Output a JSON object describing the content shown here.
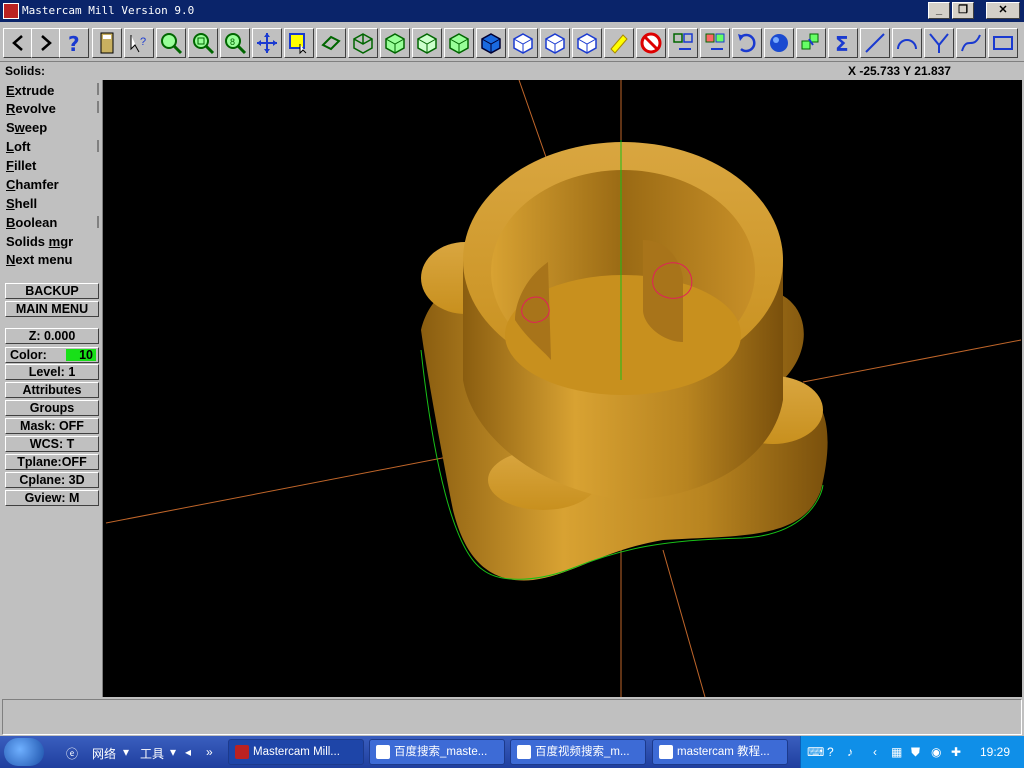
{
  "window": {
    "title": "Mastercam Mill Version 9.0"
  },
  "toolbar": {
    "buttons": [
      {
        "name": "back-arrow-icon"
      },
      {
        "name": "forward-arrow-icon"
      },
      {
        "name": "help-icon"
      },
      {
        "name": "calculator-icon"
      },
      {
        "name": "pointer-help-icon"
      },
      {
        "name": "zoom-window-icon"
      },
      {
        "name": "zoom-out-icon"
      },
      {
        "name": "zoom-fit-icon"
      },
      {
        "name": "pan-icon"
      },
      {
        "name": "select-window-icon"
      },
      {
        "name": "rotate-icon"
      },
      {
        "name": "view-top-icon"
      },
      {
        "name": "view-front-icon"
      },
      {
        "name": "view-side-icon"
      },
      {
        "name": "view-iso-icon"
      },
      {
        "name": "view-shaded-1-icon"
      },
      {
        "name": "view-shaded-2-icon"
      },
      {
        "name": "view-shaded-3-icon"
      },
      {
        "name": "view-shaded-4-icon"
      },
      {
        "name": "eraser-icon"
      },
      {
        "name": "no-entry-icon"
      },
      {
        "name": "transform-1-icon"
      },
      {
        "name": "transform-2-icon"
      },
      {
        "name": "undo-icon"
      },
      {
        "name": "sphere-icon"
      },
      {
        "name": "layers-icon"
      },
      {
        "name": "sigma-icon"
      },
      {
        "name": "line-icon"
      },
      {
        "name": "arc-icon"
      },
      {
        "name": "fillet-icon"
      },
      {
        "name": "spline-icon"
      },
      {
        "name": "rectangle-icon"
      }
    ]
  },
  "status": {
    "mode": "Solids:",
    "coords": "X -25.733  Y 21.837"
  },
  "menu": {
    "items": [
      {
        "first": "E",
        "rest": "xtrude",
        "pre": ""
      },
      {
        "first": "R",
        "rest": "evolve",
        "pre": ""
      },
      {
        "first": "w",
        "rest": "eep",
        "pre": "S"
      },
      {
        "first": "L",
        "rest": "oft",
        "pre": ""
      },
      {
        "first": "F",
        "rest": "illet",
        "pre": ""
      },
      {
        "first": "C",
        "rest": "hamfer",
        "pre": ""
      },
      {
        "first": "S",
        "rest": "hell",
        "pre": ""
      },
      {
        "first": "B",
        "rest": "oolean",
        "pre": ""
      },
      {
        "first": "m",
        "rest": "gr",
        "pre": "Solids "
      },
      {
        "first": "N",
        "rest": "ext menu",
        "pre": ""
      }
    ],
    "backup": "BACKUP",
    "main_menu": "MAIN MENU",
    "z": "Z:   0.000",
    "color_label": "Color:",
    "color_value": "10",
    "level": "Level:  1",
    "attributes": "Attributes",
    "groups": "Groups",
    "mask": "Mask:  OFF",
    "wcs": "WCS:   T",
    "tplane": "Tplane:OFF",
    "cplane": "Cplane: 3D",
    "gview": "Gview:   M"
  },
  "taskbar": {
    "network": "网络",
    "tools": "工具",
    "tasks": [
      "Mastercam Mill...",
      "百度搜索_maste...",
      "百度视频搜索_m...",
      "mastercam 教程..."
    ],
    "clock": "19:29"
  },
  "colors": {
    "titlebar": "#0a246a",
    "solid": "#c8901e",
    "axis": "#c0662a",
    "green": "#18e018"
  }
}
